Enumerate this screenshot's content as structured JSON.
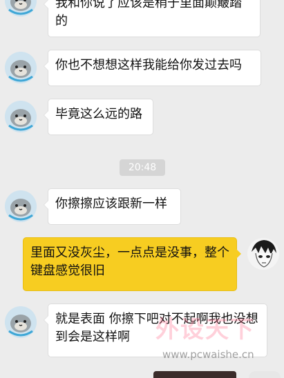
{
  "messages": [
    {
      "side": "in",
      "text": "我和你说了应该是稍于里面颠簸踏的"
    },
    {
      "side": "in",
      "text": "你也不想想这样我能给你发过去吗"
    },
    {
      "side": "in",
      "text": "毕竟这么远的路"
    },
    {
      "side": "in",
      "text": "你擦擦应该跟新一样"
    },
    {
      "side": "out",
      "text": "里面又没灰尘，一点点是没事，整个键盘感觉很旧"
    },
    {
      "side": "in",
      "text": "就是表面  你擦下吧对不起啊我也没想到会是这样啊"
    }
  ],
  "timestamp": "20:48",
  "watermark": {
    "logo": "外设天下",
    "url": "www.pcwaishe.cn"
  },
  "icons": {
    "contact_avatar": "seal-avatar-icon",
    "self_avatar": "manga-face-avatar-icon"
  },
  "colors": {
    "background": "#ececec",
    "incoming_bubble": "#ffffff",
    "outgoing_bubble": "#f7cd21",
    "time_pill": "#d5d5d5"
  }
}
